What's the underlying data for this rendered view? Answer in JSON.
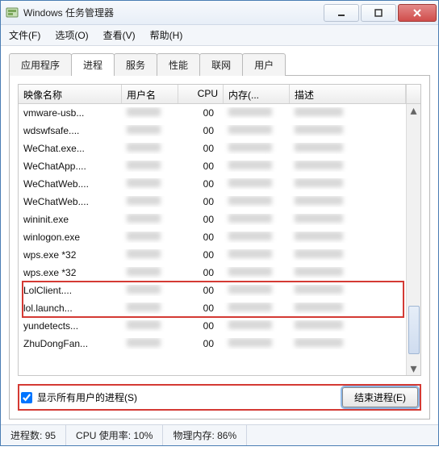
{
  "window": {
    "title": "Windows 任务管理器"
  },
  "menu": {
    "file": "文件(F)",
    "options": "选项(O)",
    "view": "查看(V)",
    "help": "帮助(H)"
  },
  "tabs": {
    "apps": "应用程序",
    "processes": "进程",
    "services": "服务",
    "performance": "性能",
    "network": "联网",
    "users": "用户"
  },
  "columns": {
    "image": "映像名称",
    "user": "用户名",
    "cpu": "CPU",
    "mem": "内存(...",
    "desc": "描述"
  },
  "rows": [
    {
      "image": "vmware-usb...",
      "cpu": "00"
    },
    {
      "image": "wdswfsafe....",
      "cpu": "00"
    },
    {
      "image": "WeChat.exe...",
      "cpu": "00"
    },
    {
      "image": "WeChatApp....",
      "cpu": "00"
    },
    {
      "image": "WeChatWeb....",
      "cpu": "00"
    },
    {
      "image": "WeChatWeb....",
      "cpu": "00"
    },
    {
      "image": "wininit.exe",
      "cpu": "00"
    },
    {
      "image": "winlogon.exe",
      "cpu": "00"
    },
    {
      "image": "wps.exe *32",
      "cpu": "00"
    },
    {
      "image": "wps.exe *32",
      "cpu": "00"
    },
    {
      "image": "LolClient....",
      "cpu": "00"
    },
    {
      "image": "lol.launch...",
      "cpu": "00"
    },
    {
      "image": "yundetects...",
      "cpu": "00"
    },
    {
      "image": "ZhuDongFan...",
      "cpu": "00"
    }
  ],
  "checkbox": {
    "label": "显示所有用户的进程(S)",
    "checked": true
  },
  "buttons": {
    "end": "结束进程(E)"
  },
  "status": {
    "processes_label": "进程数:",
    "processes": "95",
    "cpu_label": "CPU 使用率:",
    "cpu": "10%",
    "mem_label": "物理内存:",
    "mem": "86%"
  }
}
